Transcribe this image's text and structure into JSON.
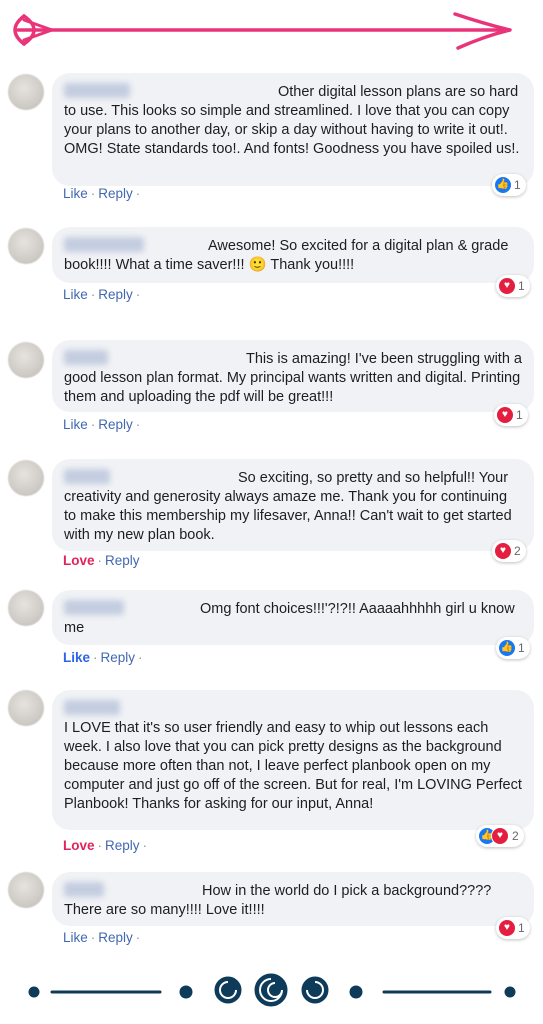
{
  "comments": [
    {
      "text": "Other digital lesson plans are so hard to use. This looks so simple and streamlined. I love that you can copy your plans to another day, or skip a day without having to write it out!. OMG! State standards too!. And fonts! Goodness you have spoiled us!.",
      "action1": "Like",
      "action2": "Reply",
      "reaction_icon": "like-icon",
      "reaction_count": "1"
    },
    {
      "text": "Awesome! So excited for a digital plan & grade book!!!! What a time saver!!! 🙂 Thank you!!!!",
      "action1": "Like",
      "action2": "Reply",
      "reaction_icon": "love-icon",
      "reaction_count": "1"
    },
    {
      "text": "This is amazing! I've been struggling with a good lesson plan format. My principal wants written and digital. Printing them and uploading the pdf will be great!!!",
      "action1": "Like",
      "action2": "Reply",
      "reaction_icon": "love-icon",
      "reaction_count": "1"
    },
    {
      "text": "So exciting, so pretty and so helpful!! Your creativity and generosity always amaze me. Thank you for continuing to make this membership my lifesaver, Anna!! Can't wait to get started with my new plan book.",
      "action1": "Love",
      "action2": "Reply",
      "reaction_icon": "love-icon",
      "reaction_count": "2"
    },
    {
      "text": "Omg font choices!!!'?!?!! Aaaaahhhhh girl u know me",
      "action1": "Like",
      "action2": "Reply",
      "reaction_icon": "like-icon",
      "reaction_count": "1"
    },
    {
      "text": "I LOVE that it's so user friendly and easy to whip out lessons each week. I also love that you can pick pretty designs as the background because more often than not, I leave perfect planbook open on my computer and just go off of the screen. But for real, I'm LOVING Perfect Planbook! Thanks for asking for our input, Anna!",
      "action1": "Love",
      "action2": "Reply",
      "reaction_icon": "like-love-icons",
      "reaction_count": "2"
    },
    {
      "text": "How in the world do I pick a background???? There are so many!!!! Love it!!!!",
      "action1": "Like",
      "action2": "Reply",
      "reaction_icon": "love-icon",
      "reaction_count": "1"
    }
  ],
  "colors": {
    "arrow": "#e9347a",
    "link": "#4267b2",
    "like_active": "#2d64e8",
    "love_active": "#e0245e",
    "divider": "#0f3b5a"
  }
}
